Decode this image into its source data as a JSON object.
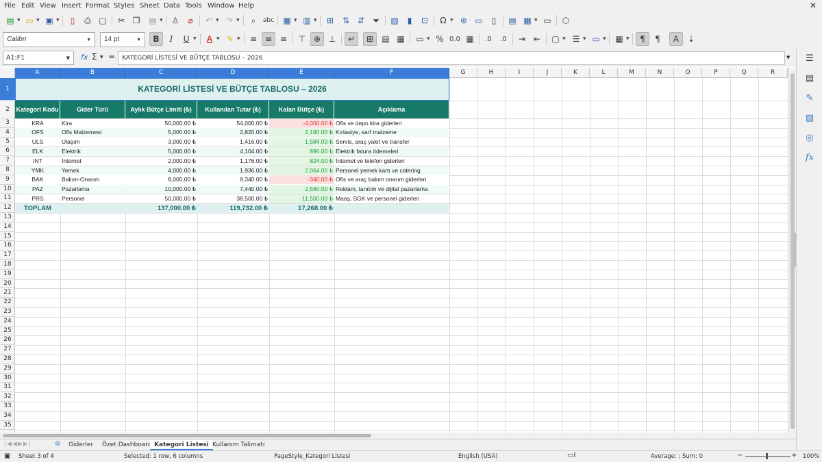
{
  "menus": [
    "File",
    "Edit",
    "View",
    "Insert",
    "Format",
    "Styles",
    "Sheet",
    "Data",
    "Tools",
    "Window",
    "Help"
  ],
  "toolbar": {
    "font_name": "Calibri",
    "font_size": "14 pt"
  },
  "formula_bar": {
    "name_box": "A1:F1",
    "content": "KATEGORİ LİSTESİ VE BÜTÇE TABLOSU – 2026"
  },
  "columns": [
    "A",
    "B",
    "C",
    "D",
    "E",
    "F",
    "G",
    "H",
    "I",
    "J",
    "K",
    "L",
    "M",
    "N",
    "O",
    "P",
    "Q",
    "R"
  ],
  "rows": [
    "1",
    "2",
    "3",
    "4",
    "5",
    "6",
    "7",
    "8",
    "9",
    "10",
    "11",
    "12",
    "13",
    "14",
    "15",
    "16",
    "17",
    "18",
    "19",
    "20",
    "21",
    "22",
    "23",
    "24",
    "25",
    "26",
    "27",
    "28",
    "29",
    "30",
    "31",
    "32",
    "33",
    "34",
    "35"
  ],
  "sheet": {
    "title": "KATEGORİ LİSTESİ VE BÜTÇE TABLOSU – 2026",
    "headers": [
      "Kategori Kodu",
      "Gider Türü",
      "Aylık Bütçe Limiti (₺)",
      "Kullanılan Tutar (₺)",
      "Kalan Bütçe (₺)",
      "Açıklama"
    ],
    "data": [
      {
        "code": "KRA",
        "type": "Kira",
        "limit": "50,000.00 ₺",
        "used": "54,000.00 ₺",
        "remaining": "-4,000.00 ₺",
        "desc": "Ofis ve depo kira giderleri"
      },
      {
        "code": "OFS",
        "type": "Ofis Malzemesi",
        "limit": "5,000.00 ₺",
        "used": "2,820.00 ₺",
        "remaining": "2,180.00 ₺",
        "desc": "Kırtasiye, sarf malzeme"
      },
      {
        "code": "ULS",
        "type": "Ulaşım",
        "limit": "3,000.00 ₺",
        "used": "1,416.00 ₺",
        "remaining": "1,584.00 ₺",
        "desc": "Servis, araç yakıt ve transfer"
      },
      {
        "code": "ELK",
        "type": "Elektrik",
        "limit": "5,000.00 ₺",
        "used": "4,104.00 ₺",
        "remaining": "896.00 ₺",
        "desc": "Elektrik fatura ödemeleri"
      },
      {
        "code": "INT",
        "type": "İnternet",
        "limit": "2,000.00 ₺",
        "used": "1,176.00 ₺",
        "remaining": "824.00 ₺",
        "desc": "İnternet ve telefon giderleri"
      },
      {
        "code": "YMK",
        "type": "Yemek",
        "limit": "4,000.00 ₺",
        "used": "1,936.00 ₺",
        "remaining": "2,064.00 ₺",
        "desc": "Personel yemek kartı ve catering"
      },
      {
        "code": "BAK",
        "type": "Bakım-Onarım",
        "limit": "8,000.00 ₺",
        "used": "8,340.00 ₺",
        "remaining": "-340.00 ₺",
        "desc": "Ofis ve araç bakım onarım giderleri"
      },
      {
        "code": "PAZ",
        "type": "Pazarlama",
        "limit": "10,000.00 ₺",
        "used": "7,440.00 ₺",
        "remaining": "2,560.00 ₺",
        "desc": "Reklam, tanıtım ve dijital pazarlama"
      },
      {
        "code": "PRS",
        "type": "Personel",
        "limit": "50,000.00 ₺",
        "used": "38,500.00 ₺",
        "remaining": "11,500.00 ₺",
        "desc": "Maaş, SGK ve personel giderleri"
      }
    ],
    "total": {
      "label": "TOPLAM",
      "limit": "137,000.00 ₺",
      "used": "119,732.00 ₺",
      "remaining": "17,268.00 ₺"
    }
  },
  "tabs": [
    "Giderler",
    "Özet Dashboard",
    "Kategori Listesi",
    "Kullanım Talimatı"
  ],
  "active_tab": "Kategori Listesi",
  "status": {
    "sheet": "Sheet 3 of 4",
    "selection": "Selected: 1 row, 6 columns",
    "page_style": "PageStyle_Kategori Listesi",
    "language": "English (USA)",
    "sum": "Average: ; Sum: 0",
    "zoom": "100%"
  }
}
